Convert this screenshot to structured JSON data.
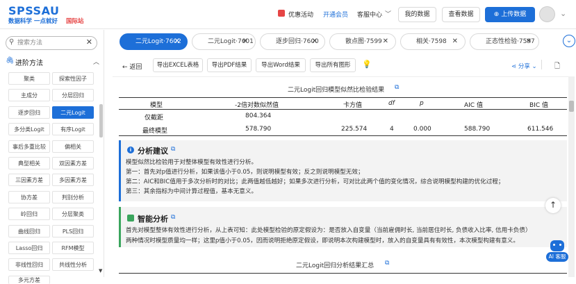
{
  "header": {
    "logo": "SPSSAU",
    "slogan": "数据科学 一点就好",
    "intl": "国际站",
    "promo": "优惠活动",
    "vip": "开通会员",
    "service": "客服中心",
    "my_data": "我的数据",
    "view_data": "查看数据",
    "upload": "上传数据"
  },
  "sidebar": {
    "search_placeholder": "搜索方法",
    "section_title": "进阶方法",
    "items": [
      [
        "聚类",
        "探索性因子"
      ],
      [
        "主成分",
        "分层回归"
      ],
      [
        "逐步回归",
        "二元Logit"
      ],
      [
        "多分类Logit",
        "有序Logit"
      ],
      [
        "事后多重比较",
        "偏相关"
      ],
      [
        "典型相关",
        "双因素方差"
      ],
      [
        "三因素方差",
        "多因素方差"
      ],
      [
        "协方差",
        "判别分析"
      ],
      [
        "岭回归",
        "分层聚类"
      ],
      [
        "曲线回归",
        "PLS回归"
      ],
      [
        "Lasso回归",
        "RFM模型"
      ],
      [
        "非线性回归",
        "共线性分析"
      ],
      [
        "多元方差",
        ""
      ]
    ]
  },
  "tabs": [
    {
      "label": "二元Logit·7602",
      "active": true
    },
    {
      "label": "二元Logit·7601",
      "active": false
    },
    {
      "label": "逐步回归·7600",
      "active": false
    },
    {
      "label": "散点图·7599",
      "active": false
    },
    {
      "label": "相关·7598",
      "active": false
    },
    {
      "label": "正态性检验·7597",
      "active": false
    }
  ],
  "toolbar": {
    "back": "返回",
    "export_excel": "导出EXCEL表格",
    "export_pdf": "导出PDF结果",
    "export_word": "导出Word结果",
    "export_all": "导出所有图形",
    "share": "分享"
  },
  "table1": {
    "title": "二元Logit回归模型似然比检验结果",
    "headers": [
      "模型",
      "-2倍对数似然值",
      "卡方值",
      "df",
      "p",
      "AIC 值",
      "BIC 值"
    ],
    "rows": [
      [
        "仅截距",
        "804.364",
        "",
        "",
        "",
        "",
        ""
      ],
      [
        "最终模型",
        "578.790",
        "225.574",
        "4",
        "0.000",
        "588.790",
        "611.546"
      ]
    ]
  },
  "analysis_advice": {
    "title": "分析建议",
    "lines": [
      "模型似然比检验用于对整体模型有效性进行分析。",
      "第一：首先对p值进行分析，如果该值小于0.05，则说明模型有效；反之则说明模型无效；",
      "第二：AIC和BIC值用于多次分析时的对比；此两值越低越好；如果多次进行分析，可对比此两个值的变化情况，综合说明模型构建的优化过程；",
      "第三：其余指标为中间计算过程值，基本无意义。"
    ]
  },
  "smart_analysis": {
    "title": "智能分析",
    "lines": [
      "首先对模型整体有效性进行分析，从上表可知：此处模型检验的原定假设为：是否放入自变量（当前雇佣时长, 当前居住时长, 负债收入比率, 信用卡负债）",
      "两种情况时模型质量均一样；这里p值小于0.05，因而说明拒绝原定假设，即说明本次构建模型时，放入的自变量具有有效性，本次模型构建有意义。"
    ]
  },
  "table2": {
    "title": "二元Logit回归分析结果汇总"
  },
  "ai_service": "AI 客服",
  "colors": {
    "brand": "#1d6fd8",
    "advice_bar": "#1d6fd8",
    "smart_bar": "#3aa55d",
    "intl": "#e64545"
  }
}
